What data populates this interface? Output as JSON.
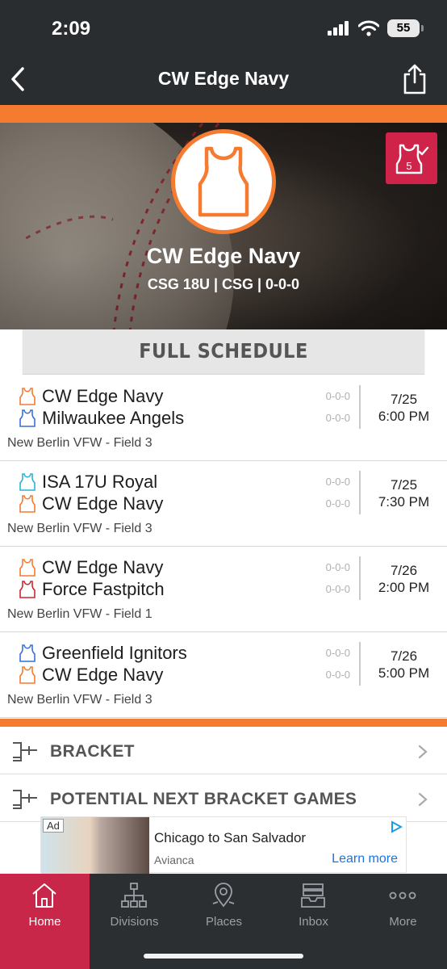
{
  "status": {
    "time": "2:09",
    "battery": "55"
  },
  "nav": {
    "title": "CW Edge Navy"
  },
  "hero": {
    "team_name": "CW Edge Navy",
    "subtitle": "CSG 18U | CSG | 0-0-0",
    "badge_count": "5"
  },
  "schedule": {
    "header": "FULL SCHEDULE",
    "games": [
      {
        "team1": "CW Edge Navy",
        "team1_color": "#f47b30",
        "team1_record": "0-0-0",
        "team2": "Milwaukee Angels",
        "team2_color": "#3a6fd8",
        "team2_record": "0-0-0",
        "date": "7/25",
        "time": "6:00 PM",
        "venue": "New Berlin VFW - Field 3"
      },
      {
        "team1": "ISA 17U Royal",
        "team1_color": "#27b3d6",
        "team1_record": "0-0-0",
        "team2": "CW Edge Navy",
        "team2_color": "#f47b30",
        "team2_record": "0-0-0",
        "date": "7/25",
        "time": "7:30 PM",
        "venue": "New Berlin VFW - Field 3"
      },
      {
        "team1": "CW Edge Navy",
        "team1_color": "#f47b30",
        "team1_record": "0-0-0",
        "team2": "Force Fastpitch",
        "team2_color": "#d0232f",
        "team2_record": "0-0-0",
        "date": "7/26",
        "time": "2:00 PM",
        "venue": "New Berlin VFW - Field 1"
      },
      {
        "team1": "Greenfield Ignitors",
        "team1_color": "#3a6fd8",
        "team1_record": "0-0-0",
        "team2": "CW Edge Navy",
        "team2_color": "#f47b30",
        "team2_record": "0-0-0",
        "date": "7/26",
        "time": "5:00 PM",
        "venue": "New Berlin VFW - Field 3"
      }
    ]
  },
  "menu": {
    "bracket": "BRACKET",
    "potential": "POTENTIAL NEXT BRACKET GAMES"
  },
  "ad": {
    "tag": "Ad",
    "title": "Chicago to San Salvador",
    "brand": "Avianca",
    "cta": "Learn more"
  },
  "tabs": {
    "home": "Home",
    "divisions": "Divisions",
    "places": "Places",
    "inbox": "Inbox",
    "more": "More"
  },
  "colors": {
    "accent": "#f47b30",
    "active_tab": "#c8274a",
    "dark": "#2a2d30"
  }
}
